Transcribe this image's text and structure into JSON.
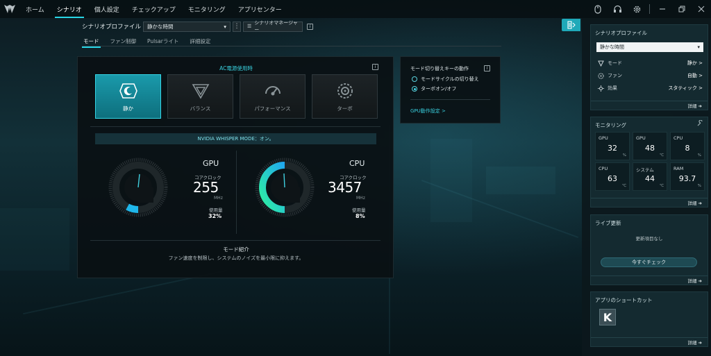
{
  "nav": {
    "tabs": [
      "ホーム",
      "シナリオ",
      "個人設定",
      "チェックアップ",
      "モニタリング",
      "アプリセンター"
    ],
    "active_index": 1
  },
  "accent_color": "#28d6e6",
  "top_icons": [
    "mouse-icon",
    "headset-icon",
    "gear-icon",
    "minimize-icon",
    "restore-icon",
    "close-icon"
  ],
  "profile": {
    "label": "シナリオプロファイル",
    "value": "静かな時間",
    "manager_label": "シナリオマネージャー"
  },
  "subtabs": [
    "モード",
    "ファン制御",
    "Pulsarライト",
    "詳細設定"
  ],
  "main": {
    "ac_title": "AC電源使用時",
    "modes": [
      {
        "label": "静か",
        "icon": "quiet-icon",
        "active": true
      },
      {
        "label": "バランス",
        "icon": "balance-icon",
        "active": false
      },
      {
        "label": "パフォーマンス",
        "icon": "performance-icon",
        "active": false
      },
      {
        "label": "ターボ",
        "icon": "turbo-icon",
        "active": false
      }
    ],
    "whisper": "NVIDIA WHISPER MODE：オン。",
    "gpu": {
      "name": "GPU",
      "clock_label": "コアクロック",
      "clock": "255",
      "unit": "MHz",
      "usage_label": "使用量",
      "usage": "32%",
      "usage_value": 32
    },
    "cpu": {
      "name": "CPU",
      "clock_label": "コアクロック",
      "clock": "3457",
      "unit": "MHz",
      "usage_label": "使用量",
      "usage": "8%",
      "usage_value": 8
    },
    "intro_title": "モード紹介",
    "intro_desc": "ファン速度を制限し、システムのノイズを最小限に抑えます。"
  },
  "hotkey": {
    "title": "モード切り替えキーの動作",
    "options": [
      "モードサイクルの切り替え",
      "ターボオン/オフ"
    ],
    "selected_index": 1,
    "link": "GPU動作設定 >"
  },
  "sidebar": {
    "profile_card": {
      "title": "シナリオプロファイル",
      "select": "静かな時間",
      "rows": [
        {
          "label": "モード",
          "value": "静か >",
          "icon": "mode-icon"
        },
        {
          "label": "ファン",
          "value": "自動 >",
          "icon": "fan-icon"
        },
        {
          "label": "効果",
          "value": "スタティック >",
          "icon": "light-effect-icon"
        }
      ],
      "detail": "詳細 ➜"
    },
    "monitor_card": {
      "title": "モニタリング",
      "cells": [
        {
          "name": "GPU",
          "value": "32",
          "unit": "%"
        },
        {
          "name": "GPU",
          "value": "48",
          "unit": "℃"
        },
        {
          "name": "CPU",
          "value": "8",
          "unit": "%"
        },
        {
          "name": "CPU",
          "value": "63",
          "unit": "℃"
        },
        {
          "name": "システム",
          "value": "44",
          "unit": "℃"
        },
        {
          "name": "RAM",
          "value": "93.7",
          "unit": "%"
        }
      ],
      "detail": "詳細 ➜"
    },
    "live_card": {
      "title": "ライブ更新",
      "empty": "更新項目なし",
      "button": "今すぐチェック",
      "detail": "詳細 ➜"
    },
    "shortcut_card": {
      "title": "アプリのショートカット",
      "app_letter": "K",
      "detail": "詳細 ➜"
    }
  }
}
